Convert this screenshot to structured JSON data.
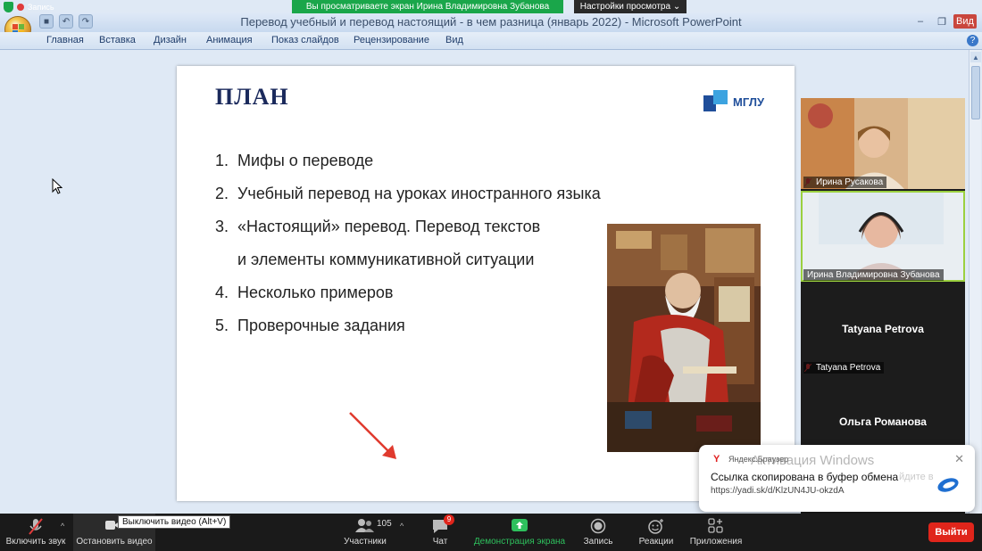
{
  "zoom": {
    "banner": "Вы просматриваете экран Ирина Владимировна Зубанова",
    "view_options": "Настройки просмотра",
    "view_options_caret": "⌄",
    "recording_label": "Запись"
  },
  "powerpoint": {
    "window_title": "Перевод учебный и перевод настоящий - в чем разница (январь 2022) - Microsoft PowerPoint",
    "ribbon_tabs": [
      "Главная",
      "Вставка",
      "Дизайн",
      "Анимация",
      "Показ слайдов",
      "Рецензирование",
      "Вид"
    ],
    "window_controls": {
      "minimize": "–",
      "restore": "❐",
      "close": "Вид"
    },
    "help": "?"
  },
  "slide": {
    "title": "ПЛАН",
    "logo_text": "МГЛУ",
    "items": [
      {
        "num": "1.",
        "text": "Мифы о переводе"
      },
      {
        "num": "2.",
        "text": "Учебный перевод на уроках иностранного языка"
      },
      {
        "num": "3.",
        "text": "«Настоящий» перевод. Перевод текстов"
      },
      {
        "num": "",
        "text": "и элементы коммуникативной ситуации"
      },
      {
        "num": "4.",
        "text": "Несколько примеров"
      },
      {
        "num": "5.",
        "text": "Проверочные задания"
      }
    ]
  },
  "participants": [
    {
      "name": "Ирина Русакова",
      "video": true,
      "muted": true
    },
    {
      "name": "Ирина Владимировна Зубанова",
      "video": true,
      "muted": false,
      "active": true
    },
    {
      "name": "Tatyana Petrova",
      "big_name": "Tatyana Petrova",
      "video": false,
      "muted": true
    },
    {
      "big_name": "Ольга Романова",
      "video": false
    }
  ],
  "toast": {
    "source": "Яндекс.Браузер",
    "source_icon": "Y",
    "headline": "Ссылка скопирована в буфер обмена",
    "url": "https://yadi.sk/d/KlzUN4JU-okzdA",
    "close": "✕",
    "watermark_title": "Активация Windows",
    "watermark_sub": "йдите в"
  },
  "toolbar": {
    "unmute": "Включить звук",
    "stop_video": "Остановить видео",
    "tooltip": "Выключить видео (Alt+V)",
    "participants": "Участники",
    "participants_count": "105",
    "chat": "Чат",
    "chat_badge": "9",
    "share": "Демонстрация экрана",
    "record": "Запись",
    "reactions": "Реакции",
    "apps": "Приложения",
    "leave": "Выйти",
    "caret": "^"
  },
  "colors": {
    "zoom_green": "#1aa64a",
    "leave_red": "#e0251b",
    "slide_title": "#1b2a5c"
  }
}
